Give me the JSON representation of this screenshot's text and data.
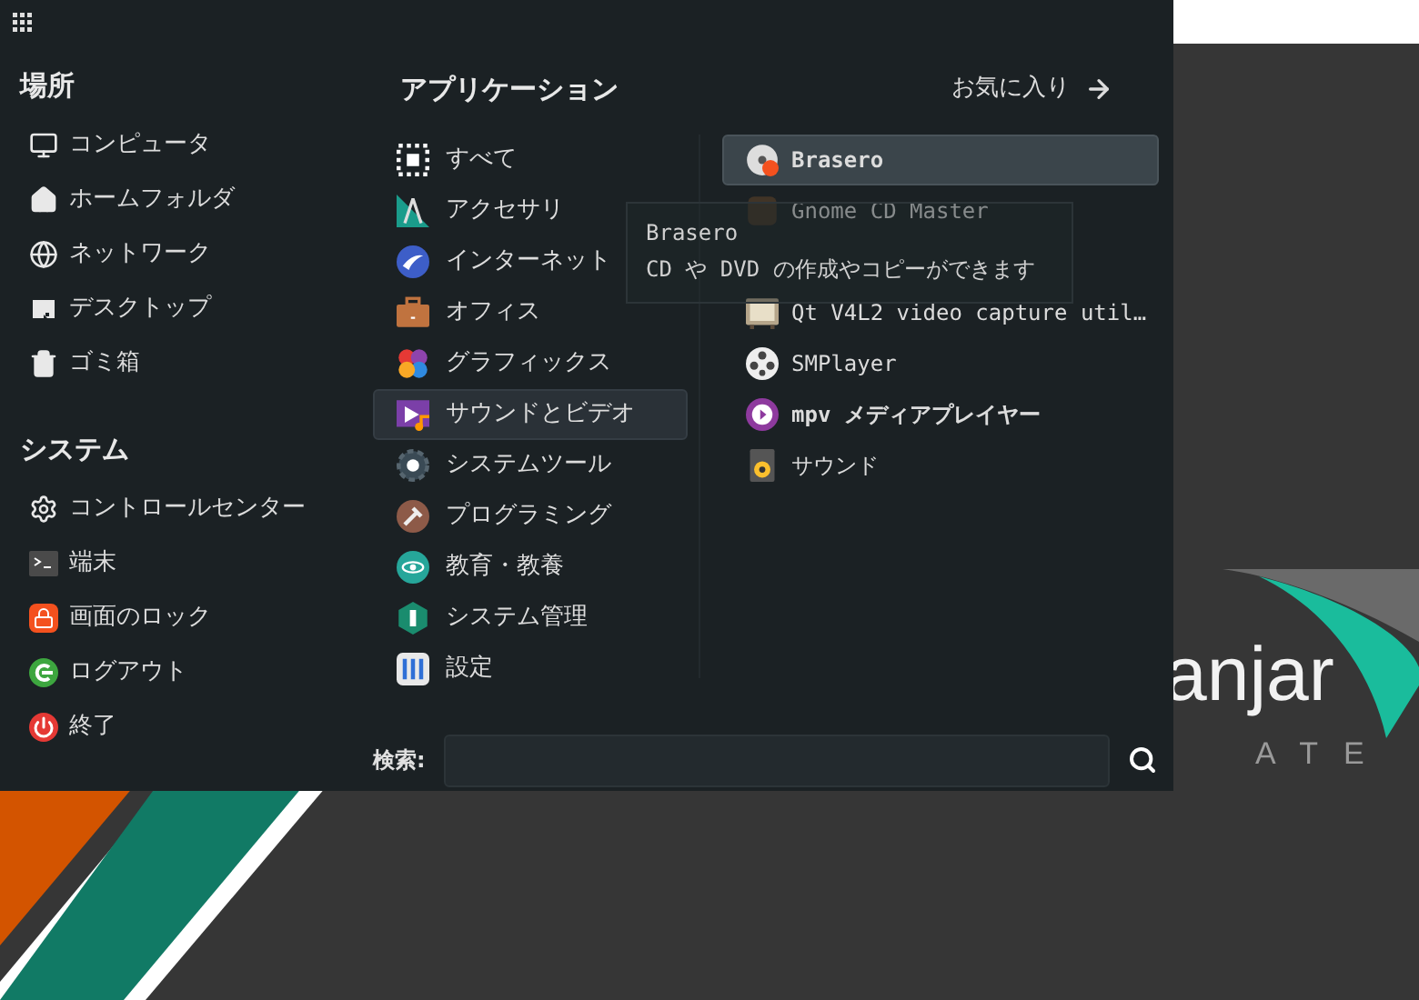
{
  "places": {
    "title": "場所",
    "items": [
      {
        "label": "コンピュータ"
      },
      {
        "label": "ホームフォルダ"
      },
      {
        "label": "ネットワーク"
      },
      {
        "label": "デスクトップ"
      },
      {
        "label": "ゴミ箱"
      }
    ]
  },
  "system": {
    "title": "システム",
    "items": [
      {
        "label": "コントロールセンター"
      },
      {
        "label": "端末"
      },
      {
        "label": "画面のロック"
      },
      {
        "label": "ログアウト"
      },
      {
        "label": "終了"
      }
    ]
  },
  "applications": {
    "title": "アプリケーション",
    "categories": [
      {
        "label": "すべて",
        "selected": false
      },
      {
        "label": "アクセサリ",
        "selected": false
      },
      {
        "label": "インターネット",
        "selected": false
      },
      {
        "label": "オフィス",
        "selected": false
      },
      {
        "label": "グラフィックス",
        "selected": false
      },
      {
        "label": "サウンドとビデオ",
        "selected": true
      },
      {
        "label": "システムツール",
        "selected": false
      },
      {
        "label": "プログラミング",
        "selected": false
      },
      {
        "label": "教育・教養",
        "selected": false
      },
      {
        "label": "システム管理",
        "selected": false
      },
      {
        "label": "設定",
        "selected": false
      }
    ]
  },
  "favorites_link": {
    "label": "お気に入り"
  },
  "apps": [
    {
      "label": "Brasero",
      "selected": true,
      "bold": true
    },
    {
      "label": "Gnome CD Master",
      "selected": false,
      "bold": false
    },
    {
      "selected": false
    },
    {
      "label": "Qt V4L2 video capture util…",
      "selected": false,
      "bold": false
    },
    {
      "label": "SMPlayer",
      "selected": false,
      "bold": false
    },
    {
      "label": "mpv メディアプレイヤー",
      "selected": false,
      "bold": true
    },
    {
      "label": "サウンド",
      "selected": false,
      "bold": false
    }
  ],
  "tooltip": {
    "title": "Brasero",
    "text": "CD や DVD の作成やコピーができます"
  },
  "search": {
    "label": "検索:"
  },
  "wallpaper": {
    "logo_text": "anjar",
    "logo_subtext": "ATE"
  }
}
